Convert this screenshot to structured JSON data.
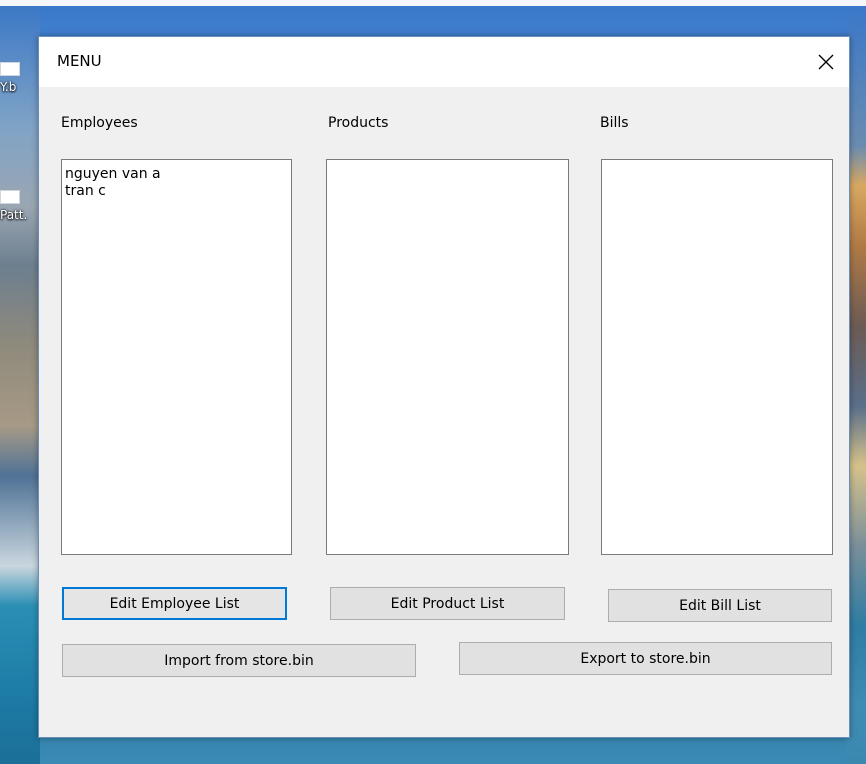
{
  "desktop": {
    "icons": [
      {
        "label": "Y.b"
      },
      {
        "label": "Patt."
      }
    ]
  },
  "window": {
    "title": "MENU",
    "close_glyph": "✕"
  },
  "groups": {
    "employees": {
      "label": "Employees",
      "items": [
        "nguyen van a",
        "tran c"
      ],
      "edit_button": "Edit Employee List"
    },
    "products": {
      "label": "Products",
      "items": [],
      "edit_button": "Edit Product List"
    },
    "bills": {
      "label": "Bills",
      "items": [],
      "edit_button": "Edit Bill List"
    }
  },
  "actions": {
    "import_label": "Import from store.bin",
    "export_label": "Export to store.bin"
  },
  "colors": {
    "window_bg": "#f0f0f0",
    "button_bg": "#e1e1e1",
    "focus_border": "#0078d7"
  }
}
